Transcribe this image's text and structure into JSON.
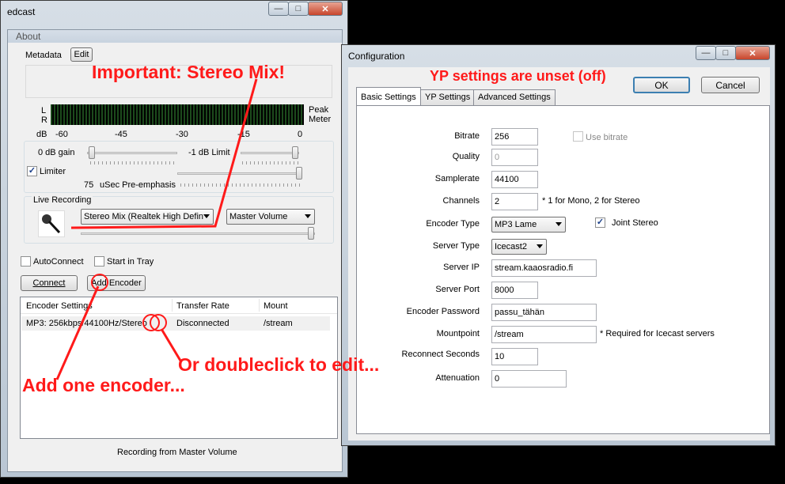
{
  "edcast": {
    "title": "edcast",
    "menu_about": "About",
    "metadata_label": "Metadata",
    "edit_button": "Edit",
    "meter_L": "L",
    "meter_R": "R",
    "meter_peak": "Peak",
    "meter_meter": "Meter",
    "meter_scale": [
      "dB",
      "-60",
      "-45",
      "-30",
      "-15",
      "0"
    ],
    "gain_label": "0 dB gain",
    "limit_label": "-1 dB Limit",
    "limiter_label": "Limiter",
    "preemph_value": "75",
    "preemph_label": "uSec Pre-emphasis",
    "live_recording_label": "Live Recording",
    "input_device": "Stereo Mix (Realtek High Defin",
    "mixer_select": "Master Volume",
    "autoconnect_label": "AutoConnect",
    "start_in_tray_label": "Start in Tray",
    "connect_button": "Connect",
    "add_encoder_button": "Add Encoder",
    "columns": [
      "Encoder Settings",
      "Transfer Rate",
      "Mount"
    ],
    "rows": [
      {
        "settings": "MP3: 256kbps/44100Hz/Stereo",
        "rate": "Disconnected",
        "mount": "/stream"
      }
    ],
    "status": "Recording from Master Volume"
  },
  "config": {
    "title": "Configuration",
    "ok_button": "OK",
    "cancel_button": "Cancel",
    "tabs": [
      "Basic Settings",
      "YP Settings",
      "Advanced Settings"
    ],
    "bitrate_label": "Bitrate",
    "bitrate_value": "256",
    "use_bitrate_label": "Use bitrate",
    "quality_label": "Quality",
    "quality_value": "0",
    "samplerate_label": "Samplerate",
    "samplerate_value": "44100",
    "channels_label": "Channels",
    "channels_value": "2",
    "channels_note": "* 1 for Mono, 2 for Stereo",
    "encoder_type_label": "Encoder Type",
    "encoder_type_value": "MP3 Lame",
    "joint_stereo_label": "Joint Stereo",
    "server_type_label": "Server Type",
    "server_type_value": "Icecast2",
    "server_ip_label": "Server IP",
    "server_ip_value": "stream.kaaosradio.fi",
    "server_port_label": "Server Port",
    "server_port_value": "8000",
    "encoder_password_label": "Encoder Password",
    "encoder_password_value": "passu_tähän",
    "mountpoint_label": "Mountpoint",
    "mountpoint_value": "/stream",
    "mountpoint_note": "* Required for Icecast servers",
    "reconnect_label": "Reconnect Seconds",
    "reconnect_value": "10",
    "attenuation_label": "Attenuation",
    "attenuation_value": "0"
  },
  "annotations": {
    "stereo_mix": "Important: Stereo Mix!",
    "yp": "YP settings are unset (off)",
    "doubleclick": "Or doubleclick to edit...",
    "add_encoder": "Add one encoder..."
  },
  "colors": {
    "annotation": "#ff1a1a",
    "close_button": "#c8452b",
    "window_frame": "#b9c6d3"
  }
}
